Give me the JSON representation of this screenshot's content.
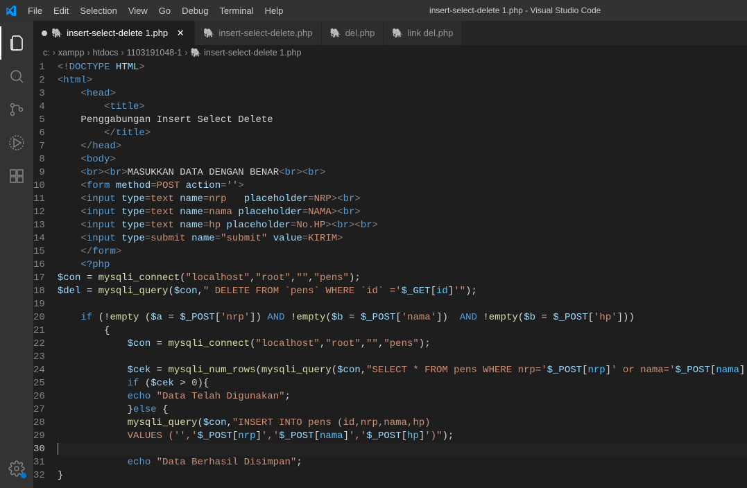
{
  "window_title": "insert-select-delete 1.php - Visual Studio Code",
  "menu": [
    "File",
    "Edit",
    "Selection",
    "View",
    "Go",
    "Debug",
    "Terminal",
    "Help"
  ],
  "activity_icons": [
    "files-icon",
    "search-icon",
    "source-control-icon",
    "debug-alt-icon",
    "extensions-icon"
  ],
  "bottom_icon": "settings-gear-icon",
  "tabs": [
    {
      "label": "insert-select-delete 1.php",
      "active": true,
      "dirty": true,
      "closeable": true
    },
    {
      "label": "insert-select-delete.php",
      "active": false
    },
    {
      "label": "del.php",
      "active": false
    },
    {
      "label": "link del.php",
      "active": false
    }
  ],
  "breadcrumb": {
    "parts": [
      "c:",
      "xampp",
      "htdocs",
      "1103191048-1"
    ],
    "file": "insert-select-delete 1.php"
  },
  "code": {
    "current_line": 30,
    "lines": [
      [
        [
          "t-pun",
          "<!"
        ],
        [
          "t-tag",
          "DOCTYPE"
        ],
        [
          "t-text",
          " "
        ],
        [
          "t-attr",
          "HTML"
        ],
        [
          "t-pun",
          ">"
        ]
      ],
      [
        [
          "t-pun",
          "<"
        ],
        [
          "t-tag",
          "html"
        ],
        [
          "t-pun",
          ">"
        ]
      ],
      [
        [
          "",
          null,
          "    "
        ],
        [
          "t-pun",
          "<"
        ],
        [
          "t-tag",
          "head"
        ],
        [
          "t-pun",
          ">"
        ]
      ],
      [
        [
          "",
          null,
          "        "
        ],
        [
          "t-pun",
          "<"
        ],
        [
          "t-tag",
          "title"
        ],
        [
          "t-pun",
          ">"
        ]
      ],
      [
        [
          "",
          null,
          "    "
        ],
        [
          "t-text",
          "Penggabungan Insert Select Delete"
        ]
      ],
      [
        [
          "",
          null,
          "        "
        ],
        [
          "t-pun",
          "</"
        ],
        [
          "t-tag",
          "title"
        ],
        [
          "t-pun",
          ">"
        ]
      ],
      [
        [
          "",
          null,
          "    "
        ],
        [
          "t-pun",
          "</"
        ],
        [
          "t-tag",
          "head"
        ],
        [
          "t-pun",
          ">"
        ]
      ],
      [
        [
          "",
          null,
          "    "
        ],
        [
          "t-pun",
          "<"
        ],
        [
          "t-tag",
          "body"
        ],
        [
          "t-pun",
          ">"
        ]
      ],
      [
        [
          "",
          null,
          "    "
        ],
        [
          "t-pun",
          "<"
        ],
        [
          "t-tag",
          "br"
        ],
        [
          "t-pun",
          "><"
        ],
        [
          "t-tag",
          "br"
        ],
        [
          "t-pun",
          ">"
        ],
        [
          "t-text",
          "MASUKKAN DATA DENGAN BENAR"
        ],
        [
          "t-pun",
          "<"
        ],
        [
          "t-tag",
          "br"
        ],
        [
          "t-pun",
          "><"
        ],
        [
          "t-tag",
          "br"
        ],
        [
          "t-pun",
          ">"
        ]
      ],
      [
        [
          "",
          null,
          "    "
        ],
        [
          "t-pun",
          "<"
        ],
        [
          "t-tag",
          "form"
        ],
        [
          "t-text",
          " "
        ],
        [
          "t-attr",
          "method"
        ],
        [
          "t-pun",
          "="
        ],
        [
          "t-val",
          "POST"
        ],
        [
          "t-text",
          " "
        ],
        [
          "t-attr",
          "action"
        ],
        [
          "t-pun",
          "="
        ],
        [
          "t-val",
          "''"
        ],
        [
          "t-pun",
          ">"
        ]
      ],
      [
        [
          "",
          null,
          "    "
        ],
        [
          "t-pun",
          "<"
        ],
        [
          "t-tag",
          "input"
        ],
        [
          "t-text",
          " "
        ],
        [
          "t-attr",
          "type"
        ],
        [
          "t-pun",
          "="
        ],
        [
          "t-val",
          "text"
        ],
        [
          "t-text",
          " "
        ],
        [
          "t-attr",
          "name"
        ],
        [
          "t-pun",
          "="
        ],
        [
          "t-val",
          "nrp"
        ],
        [
          "t-text",
          "   "
        ],
        [
          "t-attr",
          "placeholder"
        ],
        [
          "t-pun",
          "="
        ],
        [
          "t-val",
          "NRP"
        ],
        [
          "t-pun",
          "><"
        ],
        [
          "t-tag",
          "br"
        ],
        [
          "t-pun",
          ">"
        ]
      ],
      [
        [
          "",
          null,
          "    "
        ],
        [
          "t-pun",
          "<"
        ],
        [
          "t-tag",
          "input"
        ],
        [
          "t-text",
          " "
        ],
        [
          "t-attr",
          "type"
        ],
        [
          "t-pun",
          "="
        ],
        [
          "t-val",
          "text"
        ],
        [
          "t-text",
          " "
        ],
        [
          "t-attr",
          "name"
        ],
        [
          "t-pun",
          "="
        ],
        [
          "t-val",
          "nama"
        ],
        [
          "t-text",
          " "
        ],
        [
          "t-attr",
          "placeholder"
        ],
        [
          "t-pun",
          "="
        ],
        [
          "t-val",
          "NAMA"
        ],
        [
          "t-pun",
          "><"
        ],
        [
          "t-tag",
          "br"
        ],
        [
          "t-pun",
          ">"
        ]
      ],
      [
        [
          "",
          null,
          "    "
        ],
        [
          "t-pun",
          "<"
        ],
        [
          "t-tag",
          "input"
        ],
        [
          "t-text",
          " "
        ],
        [
          "t-attr",
          "type"
        ],
        [
          "t-pun",
          "="
        ],
        [
          "t-val",
          "text"
        ],
        [
          "t-text",
          " "
        ],
        [
          "t-attr",
          "name"
        ],
        [
          "t-pun",
          "="
        ],
        [
          "t-val",
          "hp"
        ],
        [
          "t-text",
          " "
        ],
        [
          "t-attr",
          "placeholder"
        ],
        [
          "t-pun",
          "="
        ],
        [
          "t-val",
          "No.HP"
        ],
        [
          "t-pun",
          "><"
        ],
        [
          "t-tag",
          "br"
        ],
        [
          "t-pun",
          "><"
        ],
        [
          "t-tag",
          "br"
        ],
        [
          "t-pun",
          ">"
        ]
      ],
      [
        [
          "",
          null,
          "    "
        ],
        [
          "t-pun",
          "<"
        ],
        [
          "t-tag",
          "input"
        ],
        [
          "t-text",
          " "
        ],
        [
          "t-attr",
          "type"
        ],
        [
          "t-pun",
          "="
        ],
        [
          "t-val",
          "submit"
        ],
        [
          "t-text",
          " "
        ],
        [
          "t-attr",
          "name"
        ],
        [
          "t-pun",
          "="
        ],
        [
          "t-val",
          "\"submit\""
        ],
        [
          "t-text",
          " "
        ],
        [
          "t-attr",
          "value"
        ],
        [
          "t-pun",
          "="
        ],
        [
          "t-val",
          "KIRIM"
        ],
        [
          "t-pun",
          ">"
        ]
      ],
      [
        [
          "",
          null,
          "    "
        ],
        [
          "t-pun",
          "</"
        ],
        [
          "t-tag",
          "form"
        ],
        [
          "t-pun",
          ">"
        ]
      ],
      [
        [
          "",
          null,
          "    "
        ],
        [
          "t-tag",
          "<?php"
        ]
      ],
      [
        [
          "t-var",
          "$con"
        ],
        [
          "t-op",
          " = "
        ],
        [
          "t-fn",
          "mysqli_connect"
        ],
        [
          "t-op",
          "("
        ],
        [
          "t-str",
          "\"localhost\""
        ],
        [
          "t-op",
          ","
        ],
        [
          "t-str",
          "\"root\""
        ],
        [
          "t-op",
          ","
        ],
        [
          "t-str",
          "\"\""
        ],
        [
          "t-op",
          ","
        ],
        [
          "t-str",
          "\"pens\""
        ],
        [
          "t-op",
          ");"
        ]
      ],
      [
        [
          "t-var",
          "$del"
        ],
        [
          "t-op",
          " = "
        ],
        [
          "t-fn",
          "mysqli_query"
        ],
        [
          "t-op",
          "("
        ],
        [
          "t-var",
          "$con"
        ],
        [
          "t-op",
          ","
        ],
        [
          "t-str",
          "\" DELETE FROM `pens` WHERE `id` ='"
        ],
        [
          "t-var",
          "$_GET"
        ],
        [
          "t-op",
          "["
        ],
        [
          "t-const",
          "id"
        ],
        [
          "t-op",
          "]"
        ],
        [
          "t-str",
          "'\""
        ],
        [
          "t-op",
          ");"
        ]
      ],
      [
        [
          "",
          ""
        ]
      ],
      [
        [
          "",
          null,
          "    "
        ],
        [
          "t-kw",
          "if"
        ],
        [
          "t-op",
          " (!"
        ],
        [
          "t-fn",
          "empty"
        ],
        [
          "t-op",
          " ("
        ],
        [
          "t-var",
          "$a"
        ],
        [
          "t-op",
          " = "
        ],
        [
          "t-var",
          "$_POST"
        ],
        [
          "t-op",
          "["
        ],
        [
          "t-str",
          "'nrp'"
        ],
        [
          "t-op",
          "]) "
        ],
        [
          "t-kw",
          "AND"
        ],
        [
          "t-op",
          " !"
        ],
        [
          "t-fn",
          "empty"
        ],
        [
          "t-op",
          "("
        ],
        [
          "t-var",
          "$b"
        ],
        [
          "t-op",
          " = "
        ],
        [
          "t-var",
          "$_POST"
        ],
        [
          "t-op",
          "["
        ],
        [
          "t-str",
          "'nama'"
        ],
        [
          "t-op",
          "])  "
        ],
        [
          "t-kw",
          "AND"
        ],
        [
          "t-op",
          " !"
        ],
        [
          "t-fn",
          "empty"
        ],
        [
          "t-op",
          "("
        ],
        [
          "t-var",
          "$b"
        ],
        [
          "t-op",
          " = "
        ],
        [
          "t-var",
          "$_POST"
        ],
        [
          "t-op",
          "["
        ],
        [
          "t-str",
          "'hp'"
        ],
        [
          "t-op",
          "]))"
        ]
      ],
      [
        [
          "",
          null,
          "        "
        ],
        [
          "t-op",
          "{"
        ]
      ],
      [
        [
          "",
          null,
          "            "
        ],
        [
          "t-var",
          "$con"
        ],
        [
          "t-op",
          " = "
        ],
        [
          "t-fn",
          "mysqli_connect"
        ],
        [
          "t-op",
          "("
        ],
        [
          "t-str",
          "\"localhost\""
        ],
        [
          "t-op",
          ","
        ],
        [
          "t-str",
          "\"root\""
        ],
        [
          "t-op",
          ","
        ],
        [
          "t-str",
          "\"\""
        ],
        [
          "t-op",
          ","
        ],
        [
          "t-str",
          "\"pens\""
        ],
        [
          "t-op",
          ");"
        ]
      ],
      [
        [
          "",
          ""
        ]
      ],
      [
        [
          "",
          null,
          "            "
        ],
        [
          "t-var",
          "$cek"
        ],
        [
          "t-op",
          " = "
        ],
        [
          "t-fn",
          "mysqli_num_rows"
        ],
        [
          "t-op",
          "("
        ],
        [
          "t-fn",
          "mysqli_query"
        ],
        [
          "t-op",
          "("
        ],
        [
          "t-var",
          "$con"
        ],
        [
          "t-op",
          ","
        ],
        [
          "t-str",
          "\"SELECT * FROM pens WHERE nrp='"
        ],
        [
          "t-var",
          "$_POST"
        ],
        [
          "t-op",
          "["
        ],
        [
          "t-const",
          "nrp"
        ],
        [
          "t-op",
          "]"
        ],
        [
          "t-str",
          "' or nama='"
        ],
        [
          "t-var",
          "$_POST"
        ],
        [
          "t-op",
          "["
        ],
        [
          "t-const",
          "nama"
        ],
        [
          "t-op",
          "]"
        ],
        [
          "t-str",
          "'\""
        ],
        [
          "t-op",
          "));"
        ]
      ],
      [
        [
          "",
          null,
          "            "
        ],
        [
          "t-kw",
          "if"
        ],
        [
          "t-op",
          " ("
        ],
        [
          "t-var",
          "$cek"
        ],
        [
          "t-op",
          " > "
        ],
        [
          "t-num",
          "0"
        ],
        [
          "t-op",
          "){"
        ]
      ],
      [
        [
          "",
          null,
          "            "
        ],
        [
          "t-kw",
          "echo"
        ],
        [
          "t-op",
          " "
        ],
        [
          "t-str",
          "\"Data Telah Digunakan\""
        ],
        [
          "t-op",
          ";"
        ]
      ],
      [
        [
          "",
          null,
          "            "
        ],
        [
          "t-op",
          "}"
        ],
        [
          "t-kw",
          "else"
        ],
        [
          "t-op",
          " {"
        ]
      ],
      [
        [
          "",
          null,
          "            "
        ],
        [
          "t-fn",
          "mysqli_query"
        ],
        [
          "t-op",
          "("
        ],
        [
          "t-var",
          "$con"
        ],
        [
          "t-op",
          ","
        ],
        [
          "t-str",
          "\"INSERT INTO pens (id,nrp,nama,hp)"
        ]
      ],
      [
        [
          "",
          null,
          "            "
        ],
        [
          "t-str",
          "VALUES ('','"
        ],
        [
          "t-var",
          "$_POST"
        ],
        [
          "t-op",
          "["
        ],
        [
          "t-const",
          "nrp"
        ],
        [
          "t-op",
          "]"
        ],
        [
          "t-str",
          "','"
        ],
        [
          "t-var",
          "$_POST"
        ],
        [
          "t-op",
          "["
        ],
        [
          "t-const",
          "nama"
        ],
        [
          "t-op",
          "]"
        ],
        [
          "t-str",
          "','"
        ],
        [
          "t-var",
          "$_POST"
        ],
        [
          "t-op",
          "["
        ],
        [
          "t-const",
          "hp"
        ],
        [
          "t-op",
          "]"
        ],
        [
          "t-str",
          "')\""
        ],
        [
          "t-op",
          ");"
        ]
      ],
      [
        [
          "",
          ""
        ]
      ],
      [
        [
          "",
          null,
          "            "
        ],
        [
          "t-kw",
          "echo"
        ],
        [
          "t-op",
          " "
        ],
        [
          "t-str",
          "\"Data Berhasil Disimpan\""
        ],
        [
          "t-op",
          ";"
        ]
      ],
      [
        [
          "t-op",
          "}"
        ]
      ]
    ]
  }
}
